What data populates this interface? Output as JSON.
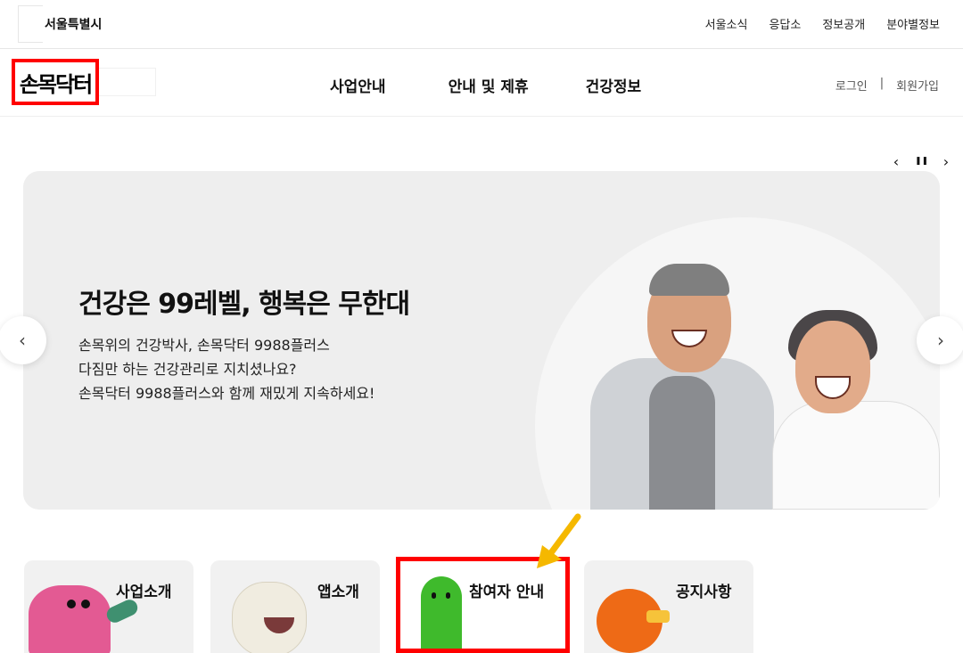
{
  "header": {
    "city_name": "서울특별시",
    "top_links": [
      "서울소식",
      "응답소",
      "정보공개",
      "분야별정보"
    ]
  },
  "nav": {
    "logo": "손목닥터",
    "menu": [
      "사업안내",
      "안내 및 제휴",
      "건강정보"
    ],
    "login": "로그인",
    "separator": "|",
    "signup": "회원가입"
  },
  "slider": {
    "prev_icon": "chevron-left-icon",
    "pause_icon": "pause-icon",
    "next_icon": "chevron-right-icon",
    "prev_glyph": "‹",
    "pause_glyph": "❚❚",
    "next_glyph": "›"
  },
  "hero": {
    "title": "건강은 99레벨, 행복은 무한대",
    "lines": [
      "손목위의 건강박사, 손목닥터 9988플러스",
      "다짐만 하는 건강관리로 지치셨나요?",
      "손목닥터 9988플러스와 함께 재밌게 지속하세요!"
    ]
  },
  "cards": [
    {
      "label": "사업소개",
      "mascot": "pink-monster"
    },
    {
      "label": "앱소개",
      "mascot": "white-tiger"
    },
    {
      "label": "참여자 안내",
      "mascot": "green-dinosaur"
    },
    {
      "label": "공지사항",
      "mascot": "orange-bird"
    }
  ],
  "colors": {
    "highlight": "#ff0000",
    "pointer_arrow": "#f5b800",
    "hero_bg": "#eeeeee",
    "card_bg": "#f1f1f1"
  }
}
